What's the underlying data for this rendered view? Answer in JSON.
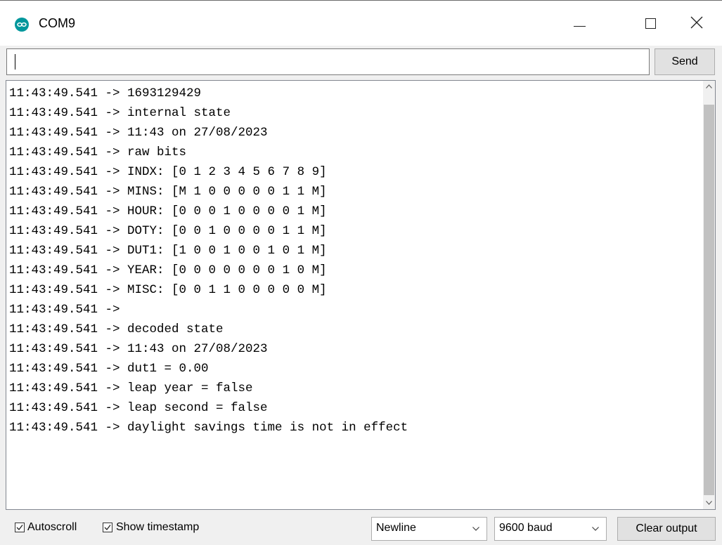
{
  "window": {
    "title": "COM9",
    "icon": "arduino-icon",
    "controls": [
      "minimize-icon",
      "maximize-icon",
      "close-icon"
    ]
  },
  "input": {
    "value": "",
    "send_label": "Send"
  },
  "output": {
    "lines": [
      "11:43:49.541 -> 1693129429",
      "11:43:49.541 -> internal state",
      "11:43:49.541 -> 11:43 on 27/08/2023",
      "11:43:49.541 -> raw bits",
      "11:43:49.541 -> INDX: [0 1 2 3 4 5 6 7 8 9]",
      "11:43:49.541 -> MINS: [M 1 0 0 0 0 0 1 1 M]",
      "11:43:49.541 -> HOUR: [0 0 0 1 0 0 0 0 1 M]",
      "11:43:49.541 -> DOTY: [0 0 1 0 0 0 0 1 1 M]",
      "11:43:49.541 -> DUT1: [1 0 0 1 0 0 1 0 1 M]",
      "11:43:49.541 -> YEAR: [0 0 0 0 0 0 0 1 0 M]",
      "11:43:49.541 -> MISC: [0 0 1 1 0 0 0 0 0 M]",
      "11:43:49.541 -> ",
      "11:43:49.541 -> decoded state",
      "11:43:49.541 -> 11:43 on 27/08/2023",
      "11:43:49.541 -> dut1 = 0.00",
      "11:43:49.541 -> leap year = false",
      "11:43:49.541 -> leap second = false",
      "11:43:49.541 -> daylight savings time is not in effect"
    ]
  },
  "footer": {
    "autoscroll_label": "Autoscroll",
    "autoscroll_checked": true,
    "timestamp_label": "Show timestamp",
    "timestamp_checked": true,
    "line_ending": "Newline",
    "baud_rate": "9600 baud",
    "clear_label": "Clear output"
  },
  "colors": {
    "icon_teal": "#00979c",
    "chrome_bg": "#f0f0f0",
    "button_bg": "#e1e1e1"
  }
}
